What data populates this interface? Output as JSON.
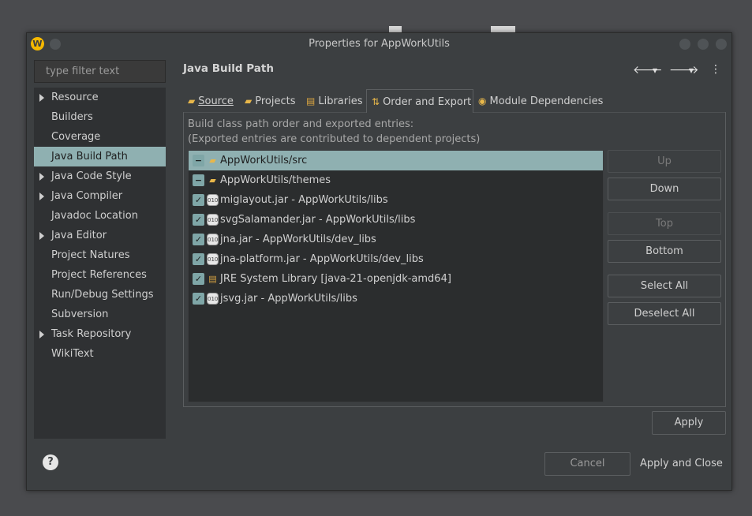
{
  "window": {
    "title": "Properties for AppWorkUtils"
  },
  "filter": {
    "placeholder": "type filter text"
  },
  "tree": [
    {
      "label": "Resource",
      "expandable": true,
      "selected": false
    },
    {
      "label": "Builders",
      "expandable": false,
      "selected": false
    },
    {
      "label": "Coverage",
      "expandable": false,
      "selected": false
    },
    {
      "label": "Java Build Path",
      "expandable": false,
      "selected": true
    },
    {
      "label": "Java Code Style",
      "expandable": true,
      "selected": false
    },
    {
      "label": "Java Compiler",
      "expandable": true,
      "selected": false
    },
    {
      "label": "Javadoc Location",
      "expandable": false,
      "selected": false
    },
    {
      "label": "Java Editor",
      "expandable": true,
      "selected": false
    },
    {
      "label": "Project Natures",
      "expandable": false,
      "selected": false
    },
    {
      "label": "Project References",
      "expandable": false,
      "selected": false
    },
    {
      "label": "Run/Debug Settings",
      "expandable": false,
      "selected": false
    },
    {
      "label": "Subversion",
      "expandable": false,
      "selected": false
    },
    {
      "label": "Task Repository",
      "expandable": true,
      "selected": false
    },
    {
      "label": "WikiText",
      "expandable": false,
      "selected": false
    }
  ],
  "page": {
    "title": "Java Build Path"
  },
  "nav": {
    "back": "🡐",
    "dropdown": "▾",
    "forward": "🡒",
    "menu": "⋮"
  },
  "tabs": [
    {
      "label": "Source",
      "icon": "folder-icon",
      "active": false
    },
    {
      "label": "Projects",
      "icon": "open-folder-icon",
      "active": false
    },
    {
      "label": "Libraries",
      "icon": "library-icon",
      "active": false
    },
    {
      "label": "Order and Export",
      "icon": "order-icon",
      "active": true
    },
    {
      "label": "Module Dependencies",
      "icon": "module-icon",
      "active": false
    }
  ],
  "description": {
    "line1": "Build class path order and exported entries:",
    "line2": "(Exported entries are contributed to dependent projects)"
  },
  "entries": [
    {
      "label": "AppWorkUtils/src",
      "state": "partial",
      "icon": "source-folder-icon",
      "selected": true
    },
    {
      "label": "AppWorkUtils/themes",
      "state": "partial",
      "icon": "source-folder-icon",
      "selected": false
    },
    {
      "label": "miglayout.jar - AppWorkUtils/libs",
      "state": "checked",
      "icon": "jar-icon",
      "selected": false
    },
    {
      "label": "svgSalamander.jar - AppWorkUtils/libs",
      "state": "checked",
      "icon": "jar-icon",
      "selected": false
    },
    {
      "label": "jna.jar - AppWorkUtils/dev_libs",
      "state": "checked",
      "icon": "jar-icon",
      "selected": false
    },
    {
      "label": "jna-platform.jar - AppWorkUtils/dev_libs",
      "state": "checked",
      "icon": "jar-icon",
      "selected": false
    },
    {
      "label": "JRE System Library [java-21-openjdk-amd64]",
      "state": "checked",
      "icon": "library-icon",
      "selected": false
    },
    {
      "label": "jsvg.jar - AppWorkUtils/libs",
      "state": "checked",
      "icon": "jar-icon",
      "selected": false
    }
  ],
  "side_buttons": {
    "up": "Up",
    "down": "Down",
    "top": "Top",
    "bottom": "Bottom",
    "select_all": "Select All",
    "deselect_all": "Deselect All"
  },
  "footer": {
    "apply": "Apply",
    "cancel": "Cancel",
    "apply_close": "Apply and Close",
    "help": "?"
  }
}
